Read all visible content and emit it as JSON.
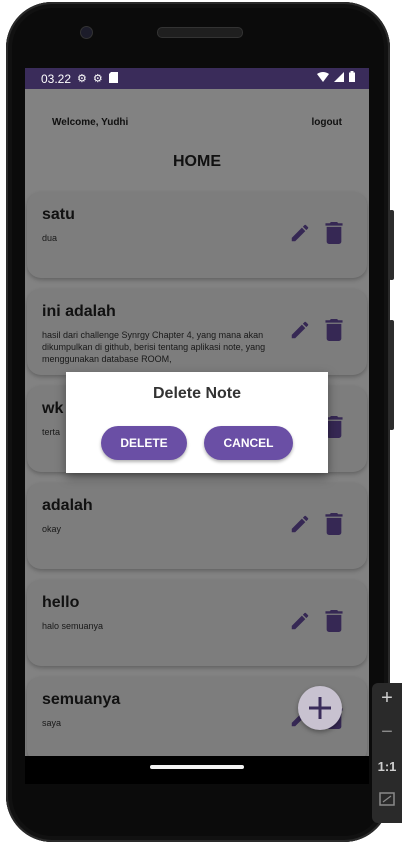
{
  "status_bar": {
    "time": "03.22",
    "left_icons": [
      "gear-icon",
      "gear-icon",
      "sd-card-icon"
    ],
    "right_icons": [
      "wifi-icon",
      "signal-icon",
      "battery-icon"
    ]
  },
  "header": {
    "welcome": "Welcome, Yudhi",
    "logout": "logout",
    "title": "HOME"
  },
  "notes": [
    {
      "title": "satu",
      "body": "dua"
    },
    {
      "title": "ini adalah",
      "body": "hasil dari challenge Synrgy Chapter 4, yang mana akan dikumpulkan di github, berisi tentang aplikasi note, yang menggunakan database ROOM,"
    },
    {
      "title": "wk",
      "body": "terta"
    },
    {
      "title": "adalah",
      "body": "okay"
    },
    {
      "title": "hello",
      "body": "halo semuanya"
    },
    {
      "title": "semuanya",
      "body": "saya"
    }
  ],
  "dialog": {
    "title": "Delete Note",
    "delete_label": "DELETE",
    "cancel_label": "CANCEL"
  },
  "fab": {
    "icon": "plus-icon"
  },
  "emulator_controls": {
    "zoom_in": "+",
    "zoom_out": "−",
    "actual_size": "1:1"
  },
  "colors": {
    "accent": "#6a4fa5",
    "icon": "#3a2c5a",
    "status_bar": "#3a2c5a"
  }
}
